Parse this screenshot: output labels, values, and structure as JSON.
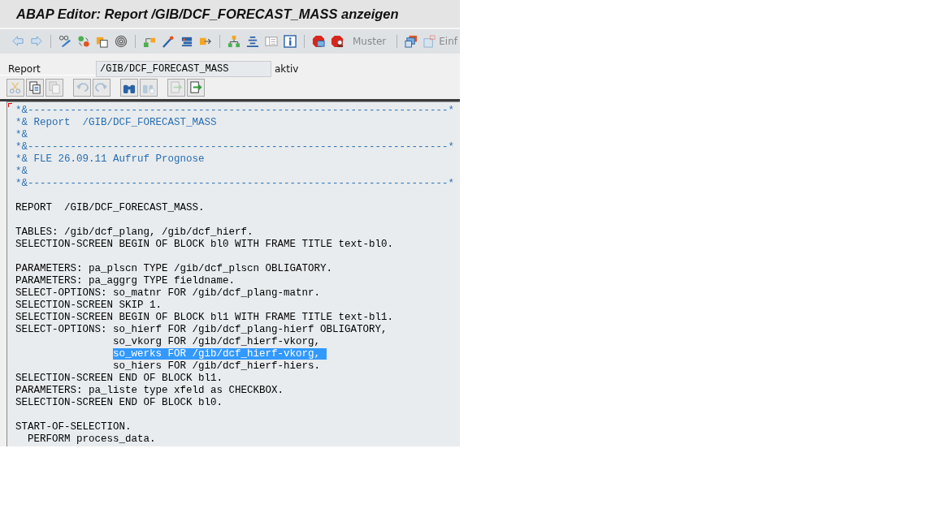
{
  "window": {
    "title": "ABAP Editor: Report /GIB/DCF_FORECAST_MASS anzeigen"
  },
  "toolbar": {
    "items": [
      {
        "kind": "icon"
      },
      {
        "kind": "icon"
      },
      {
        "kind": "sep"
      },
      {
        "kind": "icon"
      },
      {
        "kind": "icon"
      },
      {
        "kind": "icon"
      },
      {
        "kind": "icon"
      },
      {
        "kind": "sep"
      },
      {
        "kind": "icon"
      },
      {
        "kind": "icon"
      },
      {
        "kind": "icon"
      },
      {
        "kind": "icon"
      },
      {
        "kind": "sep"
      },
      {
        "kind": "icon"
      },
      {
        "kind": "icon"
      },
      {
        "kind": "icon"
      },
      {
        "kind": "icon"
      },
      {
        "kind": "sep"
      },
      {
        "kind": "icon"
      },
      {
        "kind": "icon"
      },
      {
        "kind": "text",
        "label": "Muster",
        "disabled": true
      },
      {
        "kind": "sep"
      },
      {
        "kind": "icon"
      },
      {
        "kind": "iconText",
        "label": "Einf",
        "disabled": true
      }
    ]
  },
  "report": {
    "label": "Report",
    "value": "/GIB/DCF_FORECAST_MASS",
    "status": "aktiv"
  },
  "editor_toolbar": [
    {
      "kind": "button",
      "disabled": true
    },
    {
      "kind": "button",
      "disabled": false
    },
    {
      "kind": "button",
      "disabled": true
    },
    {
      "kind": "gap"
    },
    {
      "kind": "button",
      "disabled": true
    },
    {
      "kind": "button",
      "disabled": true
    },
    {
      "kind": "gap"
    },
    {
      "kind": "button",
      "disabled": false
    },
    {
      "kind": "button",
      "disabled": true
    },
    {
      "kind": "gap"
    },
    {
      "kind": "button",
      "disabled": true
    },
    {
      "kind": "button",
      "disabled": false
    }
  ],
  "code": [
    {
      "kind": "comment",
      "text": "*&---------------------------------------------------------------------*",
      "selected": false
    },
    {
      "kind": "comment",
      "text": "*& Report  /GIB/DCF_FORECAST_MASS",
      "selected": false
    },
    {
      "kind": "comment",
      "text": "*&",
      "selected": false
    },
    {
      "kind": "comment",
      "text": "*&---------------------------------------------------------------------*",
      "selected": false
    },
    {
      "kind": "comment",
      "text": "*& FLE 26.09.11 Aufruf Prognose",
      "selected": false
    },
    {
      "kind": "comment",
      "text": "*&",
      "selected": false
    },
    {
      "kind": "comment",
      "text": "*&---------------------------------------------------------------------*",
      "selected": false
    },
    {
      "kind": "blank"
    },
    {
      "kind": "code",
      "text": "REPORT  /GIB/DCF_FORECAST_MASS.",
      "selected": false
    },
    {
      "kind": "blank"
    },
    {
      "kind": "code",
      "text": "TABLES: /gib/dcf_plang, /gib/dcf_hierf.",
      "selected": false
    },
    {
      "kind": "code",
      "text": "SELECTION-SCREEN BEGIN OF BLOCK bl0 WITH FRAME TITLE text-bl0.",
      "selected": false
    },
    {
      "kind": "blank"
    },
    {
      "kind": "code",
      "text": "PARAMETERS: pa_plscn TYPE /gib/dcf_plscn OBLIGATORY.",
      "selected": false
    },
    {
      "kind": "code",
      "text": "PARAMETERS: pa_aggrg TYPE fieldname.",
      "selected": false
    },
    {
      "kind": "code",
      "text": "SELECT-OPTIONS: so_matnr FOR /gib/dcf_plang-matnr.",
      "selected": false
    },
    {
      "kind": "code",
      "text": "SELECTION-SCREEN SKIP 1.",
      "selected": false
    },
    {
      "kind": "code",
      "text": "SELECTION-SCREEN BEGIN OF BLOCK bl1 WITH FRAME TITLE text-bl1.",
      "selected": false
    },
    {
      "kind": "code",
      "text": "SELECT-OPTIONS: so_hierf FOR /gib/dcf_plang-hierf OBLIGATORY,",
      "selected": false
    },
    {
      "kind": "code",
      "text": "                so_vkorg FOR /gib/dcf_hierf-vkorg,",
      "selected": false
    },
    {
      "kind": "code",
      "text": "                so_werks FOR /gib/dcf_hierf-vkorg,",
      "selected": true
    },
    {
      "kind": "code",
      "text": "                so_hiers FOR /gib/dcf_hierf-hiers.",
      "selected": false
    },
    {
      "kind": "code",
      "text": "SELECTION-SCREEN END OF BLOCK bl1.",
      "selected": false
    },
    {
      "kind": "code",
      "text": "PARAMETERS: pa_liste type xfeld as CHECKBOX.",
      "selected": false
    },
    {
      "kind": "code",
      "text": "SELECTION-SCREEN END OF BLOCK bl0.",
      "selected": false
    },
    {
      "kind": "blank"
    },
    {
      "kind": "code",
      "text": "START-OF-SELECTION.",
      "selected": false
    },
    {
      "kind": "code",
      "text": "  PERFORM process_data.",
      "selected": false
    }
  ]
}
